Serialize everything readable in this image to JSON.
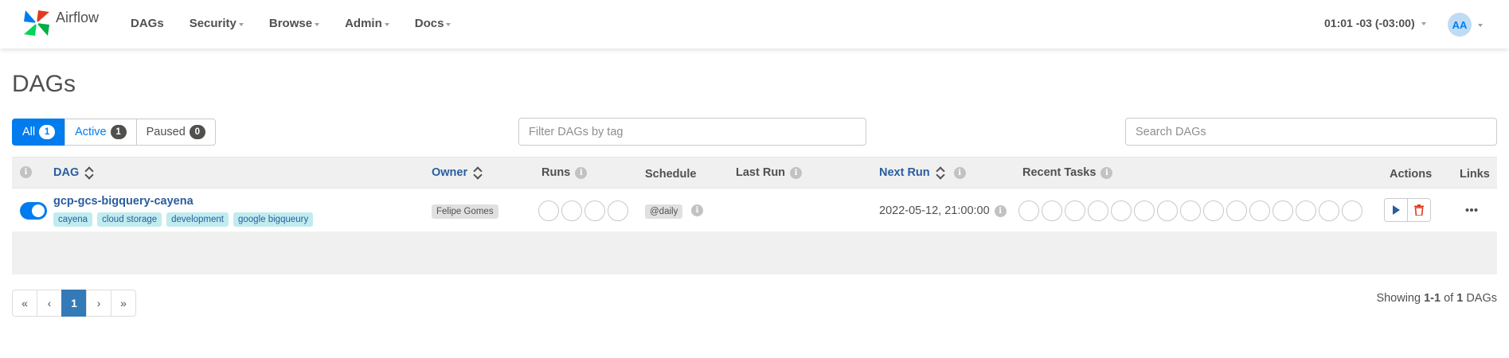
{
  "navbar": {
    "brand": "Airflow",
    "items": [
      {
        "label": "DAGs",
        "dropdown": false
      },
      {
        "label": "Security",
        "dropdown": true
      },
      {
        "label": "Browse",
        "dropdown": true
      },
      {
        "label": "Admin",
        "dropdown": true
      },
      {
        "label": "Docs",
        "dropdown": true
      }
    ],
    "clock": "01:01 -03 (-03:00)",
    "user_initials": "AA"
  },
  "page": {
    "title": "DAGs"
  },
  "filters": {
    "status": [
      {
        "label": "All",
        "count": "1"
      },
      {
        "label": "Active",
        "count": "1"
      },
      {
        "label": "Paused",
        "count": "0"
      }
    ],
    "tag_placeholder": "Filter DAGs by tag",
    "search_placeholder": "Search DAGs"
  },
  "table": {
    "headers": {
      "dag": "DAG",
      "owner": "Owner",
      "runs": "Runs",
      "schedule": "Schedule",
      "last_run": "Last Run",
      "next_run": "Next Run",
      "recent_tasks": "Recent Tasks",
      "actions": "Actions",
      "links": "Links"
    },
    "rows": [
      {
        "active": true,
        "dag_id": "gcp-gcs-bigquery-cayena",
        "tags": [
          "cayena",
          "cloud storage",
          "development",
          "google bigqueury"
        ],
        "owner": "Felipe Gomes",
        "runs_circles": 4,
        "schedule": "@daily",
        "last_run": "",
        "next_run": "2022-05-12, 21:00:00",
        "recent_task_circles": 15
      }
    ]
  },
  "pagination": {
    "first": "«",
    "prev": "‹",
    "current": "1",
    "next": "›",
    "last": "»"
  },
  "summary": {
    "prefix": "Showing ",
    "range": "1-1",
    "of": " of ",
    "total": "1",
    "suffix": " DAGs"
  },
  "colors": {
    "primary": "#017cee",
    "link": "#2a5d9f",
    "tag_bg": "#c0ecef",
    "delete_red": "#e43921"
  },
  "icons": {
    "trigger": "play-icon",
    "delete": "trash-icon",
    "links": "more-dots-icon",
    "info": "info-icon",
    "sort": "sort-icon"
  }
}
